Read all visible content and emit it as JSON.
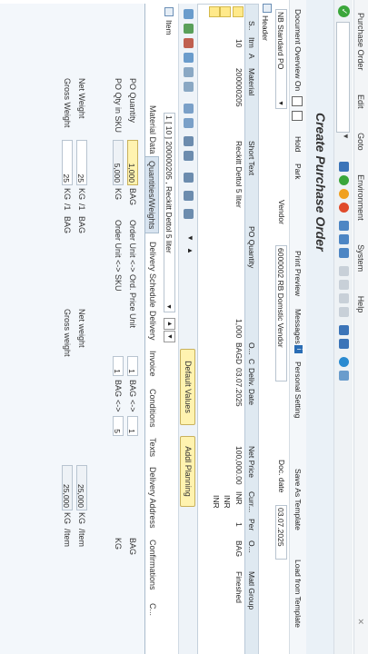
{
  "menu": {
    "items": [
      "Purchase Order",
      "Edit",
      "Goto",
      "Environment",
      "System",
      "Help"
    ]
  },
  "title": "Create Purchase Order",
  "toolbar": {
    "doc_overview": "Document Overview On",
    "hold": "Hold",
    "park": "Park",
    "print_preview": "Print Preview",
    "messages": "Messages",
    "personal_setting": "Personal Setting",
    "save_as_template": "Save As Template",
    "load_from_template": "Load from Template"
  },
  "header": {
    "po_type": "NB Standard PO",
    "vendor_label": "Vendor",
    "vendor_value": "6000002 RB Domstic Vendor",
    "doc_date_label": "Doc. date",
    "doc_date_value": "03.07.2025",
    "header_label": "Header"
  },
  "items_table": {
    "columns": [
      "S..",
      "Itm",
      "A",
      "I",
      "Material",
      "Short Text",
      "PO Quantity",
      "O...",
      "C",
      "Deliv. Date",
      "Net Price",
      "Curr...",
      "Per",
      "O...",
      "Matl Group"
    ],
    "rows": [
      {
        "itm": "10",
        "material": "200000205",
        "short_text": "Reckitt Dettol 5 liter",
        "po_qty": "1,000",
        "ou": "BAG",
        "c": "D",
        "deliv_date": "03.07.2025",
        "net_price": "100,000.00",
        "curr": "INR",
        "per": "1",
        "opu": "BAG",
        "matl_group": "Fineshed"
      },
      {
        "curr": "INR"
      },
      {
        "curr": "INR"
      }
    ]
  },
  "buttons": {
    "default_values": "Default Values",
    "addl_planning": "Addl Planning"
  },
  "item_detail": {
    "item_label": "Item",
    "item_value": "1 [ 10 ] 200000205 , Reckitt Dettol 5 liter",
    "tabs": [
      "Material Data",
      "Quantities/Weights",
      "Delivery Schedule",
      "Delivery",
      "Invoice",
      "Conditions",
      "Texts",
      "Delivery Address",
      "Confirmations",
      "C..."
    ],
    "po_quantity_label": "PO Quantity",
    "po_quantity_value": "1,000",
    "po_quantity_unit": "BAG",
    "po_qty_sku_label": "PO Qty in SKU",
    "po_qty_sku_value": "5,000",
    "po_qty_sku_unit": "KG",
    "order_unit_ord_label": "Order Unit <-> Ord. Price Unit",
    "order_unit_ord_a": "1",
    "order_unit_ord_a_unit": "BAG",
    "order_unit_ord_arrow": "<->",
    "order_unit_ord_b": "1",
    "order_unit_ord_b_unit": "BAG",
    "order_unit_sku_label": "Order Unit <-> SKU",
    "order_unit_sku_a": "1",
    "order_unit_sku_a_unit": "BAG",
    "order_unit_sku_arrow": "<->",
    "order_unit_sku_b": "5",
    "order_unit_sku_b_unit": "KG",
    "net_weight_label": "Net Weight",
    "net_weight_value": "25",
    "net_weight_unit": "KG",
    "net_weight_per": "/1",
    "net_weight_per_unit": "BAG",
    "gross_weight_label": "Gross Weight",
    "gross_weight_value": "25",
    "gross_weight_unit": "KG",
    "gross_weight_per": "/1",
    "gross_weight_per_unit": "BAG",
    "net_weight2_label": "Net weight",
    "net_weight2_value": "25,000",
    "net_weight2_unit": "KG",
    "net_weight2_per": "/Item",
    "gross_weight2_label": "Gross weight",
    "gross_weight2_value": "25,000",
    "gross_weight2_unit": "KG",
    "gross_weight2_per": "/Item"
  }
}
